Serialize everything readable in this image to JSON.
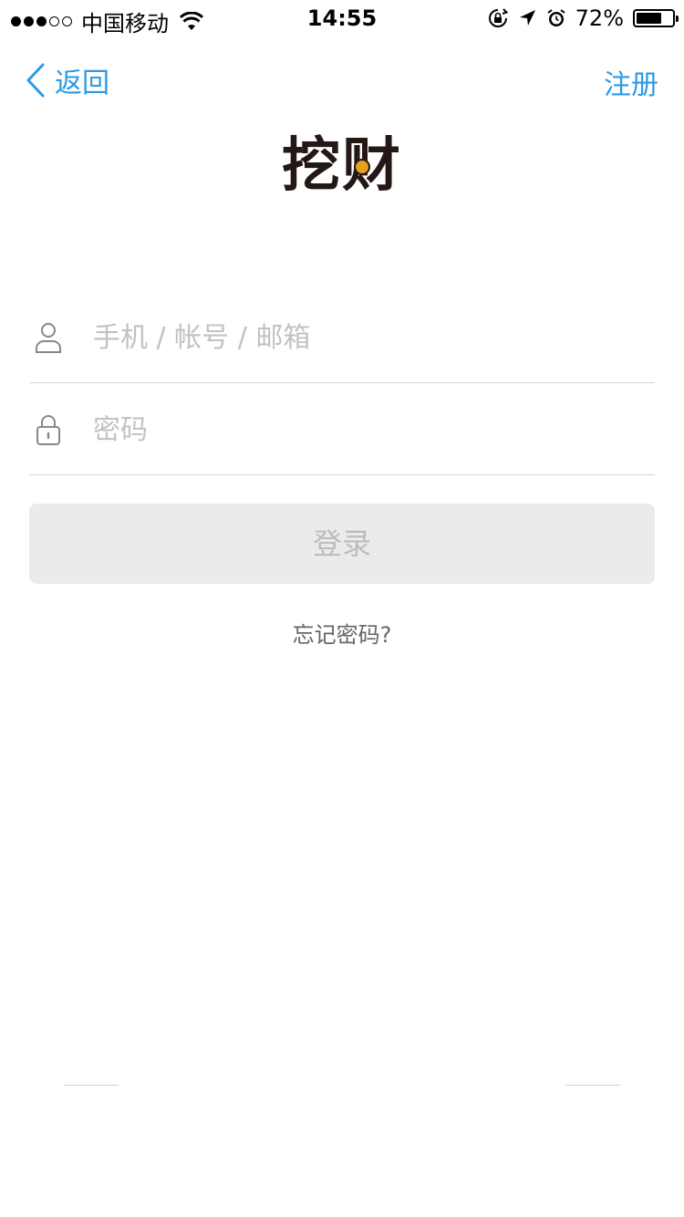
{
  "status_bar": {
    "carrier": "中国移动",
    "time": "14:55",
    "battery_percent": "72%",
    "battery_level": 0.72,
    "icons": [
      "signal-dots-icon",
      "wifi-icon",
      "rotation-lock-icon",
      "location-arrow-icon",
      "alarm-icon",
      "battery-icon"
    ]
  },
  "nav": {
    "back_label": "返回",
    "register_label": "注册"
  },
  "logo": {
    "text": "挖财"
  },
  "form": {
    "account_placeholder": "手机 / 帐号 / 邮箱",
    "account_value": "",
    "password_placeholder": "密码",
    "password_value": "",
    "login_label": "登录",
    "forgot_label": "忘记密码?"
  },
  "colors": {
    "accent": "#2a9be5",
    "button_disabled_bg": "#ebebeb",
    "button_disabled_text": "#bdbdbd",
    "divider": "#d6d6d6",
    "placeholder": "#c2c2c2"
  }
}
